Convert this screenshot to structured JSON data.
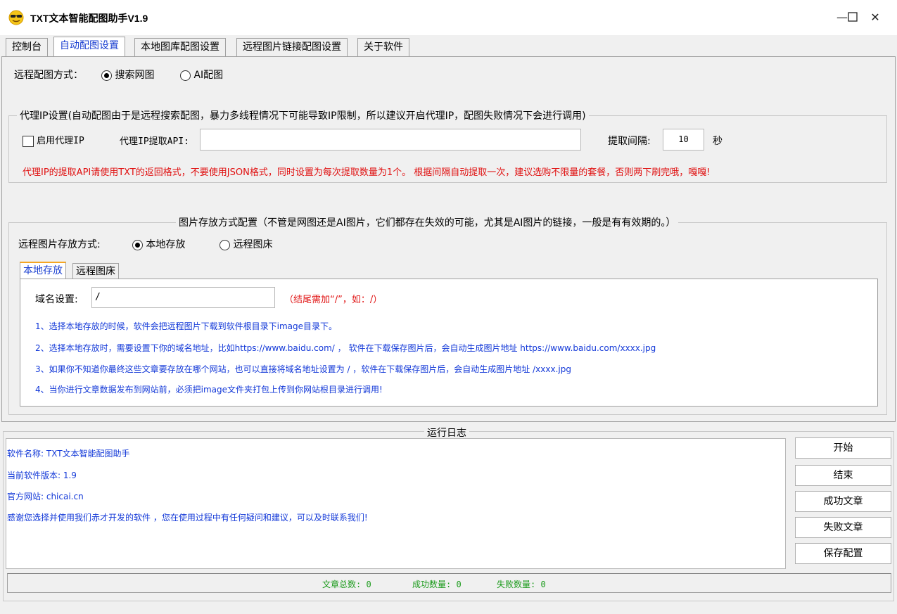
{
  "window": {
    "title": "TXT文本智能配图助手V1.9",
    "minimize": "—",
    "maximize": "☐",
    "close": "✕"
  },
  "tabs": [
    {
      "label": "控制台"
    },
    {
      "label": "自动配图设置"
    },
    {
      "label": "本地图库配图设置"
    },
    {
      "label": "远程图片链接配图设置"
    },
    {
      "label": "关于软件"
    }
  ],
  "remote_mode": {
    "label": "远程配图方式：",
    "option1": "搜索网图",
    "option2": "AI配图",
    "selected": "搜索网图"
  },
  "proxy": {
    "legend": "代理IP设置(自动配图由于是远程搜索配图，暴力多线程情况下可能导致IP限制，所以建议开启代理IP，配图失败情况下会进行调用)",
    "enable_label": "启用代理IP",
    "enabled": false,
    "api_label": "代理IP提取API:",
    "api_value": "",
    "interval_label": "提取间隔:",
    "interval_value": "10",
    "interval_unit": "秒",
    "warning": "代理IP的提取API请使用TXT的返回格式，不要使用JSON格式，同时设置为每次提取数量为1个。   根据间隔自动提取一次，建议选购不限量的套餐，否则两下刷完哦，嘎嘎!"
  },
  "storage": {
    "legend": "图片存放方式配置（不管是网图还是AI图片，它们都存在失效的可能，尤其是AI图片的链接，一般是有有效期的。）",
    "mode_label": "远程图片存放方式:",
    "option1": "本地存放",
    "option2": "远程图床",
    "selected": "本地存放",
    "subtab1": "本地存放",
    "subtab2": "远程图床",
    "domain_label": "域名设置:",
    "domain_value": "/",
    "domain_hint": "（结尾需加“/”，如：/）",
    "notes": [
      "1、选择本地存放的时候，软件会把远程图片下载到软件根目录下image目录下。",
      "2、选择本地存放时，需要设置下你的域名地址，比如https://www.baidu.com/  ，  软件在下载保存图片后，会自动生成图片地址 https://www.baidu.com/xxxx.jpg",
      "3、如果你不知道你最终这些文章要存放在哪个网站，也可以直接将域名地址设置为 /  ，软件在下载保存图片后，会自动生成图片地址 /xxxx.jpg",
      "4、当你进行文章数据发布到网站前，必须把image文件夹打包上传到你网站根目录进行调用!"
    ]
  },
  "log": {
    "legend": "运行日志",
    "lines": [
      "软件名称: TXT文本智能配图助手",
      "当前软件版本: 1.9",
      "官方网站: chicai.cn",
      "感谢您选择并使用我们赤才开发的软件 ，您在使用过程中有任何疑问和建议，可以及时联系我们!"
    ]
  },
  "buttons": {
    "start": "开始",
    "stop": "结束",
    "success": "成功文章",
    "fail": "失败文章",
    "save": "保存配置"
  },
  "status": {
    "total": "文章总数: 0",
    "success": "成功数量: 0",
    "fail": "失败数量: 0"
  },
  "colors": {
    "accent_blue": "#1238d8",
    "warning_red": "#e01010",
    "status_green": "#1a9a1a",
    "active_tab_underline": "#f5a623"
  },
  "icons": {
    "app": "sunglasses-emoji-icon"
  }
}
